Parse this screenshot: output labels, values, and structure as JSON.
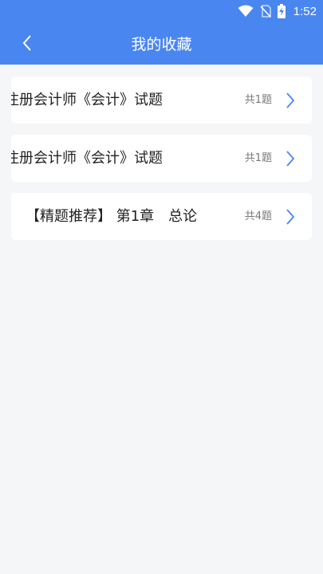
{
  "status_bar": {
    "time": "1:52",
    "icons": [
      "wifi-icon",
      "no-sim-icon",
      "battery-charging-icon"
    ]
  },
  "header": {
    "title": "我的收藏",
    "back_icon": "chevron-left-icon",
    "background_color": "#4a86f0"
  },
  "favorites": [
    {
      "title": "注册会计师《会计》试题",
      "count": "共1题"
    },
    {
      "title": "注册会计师《会计》试题",
      "count": "共1题"
    },
    {
      "title": "【精题推荐】 第1章　总论",
      "count": "共4题"
    }
  ],
  "colors": {
    "accent": "#4a86f0",
    "background": "#f5f6f7",
    "card": "#ffffff",
    "chevron": "#4a86f0"
  }
}
